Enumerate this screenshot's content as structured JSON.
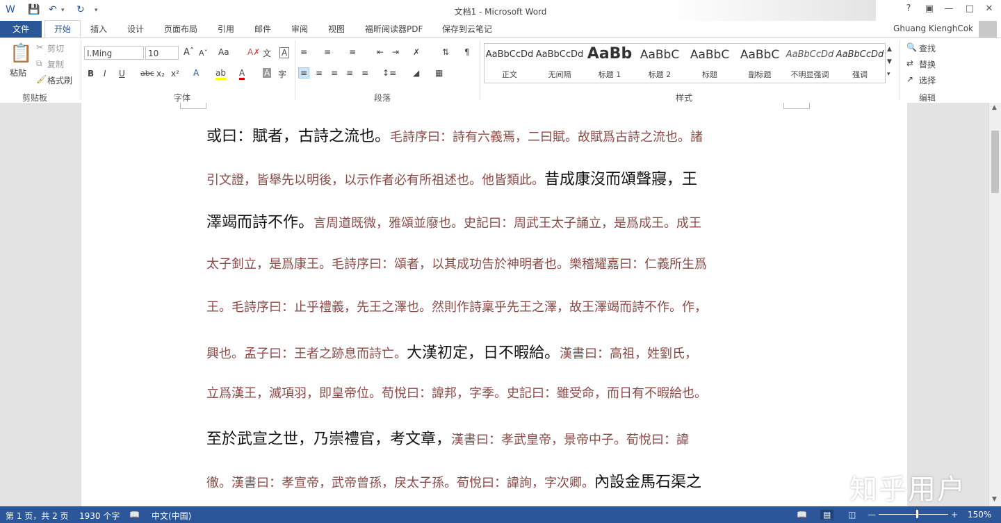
{
  "window": {
    "title": "文档1 - Microsoft Word"
  },
  "tabs": {
    "file": "文件",
    "items": [
      "开始",
      "插入",
      "设计",
      "页面布局",
      "引用",
      "邮件",
      "审阅",
      "视图",
      "福昕阅读器PDF",
      "保存到云笔记"
    ],
    "active": "开始"
  },
  "user": {
    "name": "Ghuang KienghCok"
  },
  "ribbon": {
    "clipboard": {
      "label": "剪贴板",
      "paste": "粘贴",
      "cut": "剪切",
      "copy": "复制",
      "format_painter": "格式刷"
    },
    "font": {
      "label": "字体",
      "name": "I.Ming",
      "size": "10",
      "bold": "B",
      "italic": "I",
      "underline": "U",
      "strike": "abc",
      "sub": "x₂",
      "sup": "x²",
      "case": "Aa"
    },
    "paragraph": {
      "label": "段落"
    },
    "styles": {
      "label": "样式",
      "items": [
        {
          "sample": "AaBbCcDd",
          "name": "正文"
        },
        {
          "sample": "AaBbCcDd",
          "name": "无间隔"
        },
        {
          "sample": "AaBb",
          "name": "标题 1"
        },
        {
          "sample": "AaBbC",
          "name": "标题 2"
        },
        {
          "sample": "AaBbC",
          "name": "标题"
        },
        {
          "sample": "AaBbC",
          "name": "副标题"
        },
        {
          "sample": "AaBbCcDd",
          "name": "不明显强调"
        },
        {
          "sample": "AaBbCcDd",
          "name": "强调"
        }
      ]
    },
    "editing": {
      "label": "编辑",
      "find": "查找",
      "replace": "替换",
      "select": "选择"
    }
  },
  "document": {
    "lines": [
      {
        "main": "或曰：賦者，古詩之流也。",
        "note": "毛詩序曰：詩有六義焉，二曰賦。故賦爲古詩之流也。諸"
      },
      {
        "note": "引文證，皆舉先以明後，以示作者必有所祖述也。他皆類此。",
        "main": "昔成康沒而頌聲寢，王"
      },
      {
        "main": "澤竭而詩不作。",
        "note": "言周道既微，雅頌並廢也。史記曰：周武王太子誦立，是爲成王。成王"
      },
      {
        "note": "太子釗立，是爲康王。毛詩序曰：頌者，以其成功告於神明者也。樂稽耀嘉曰：仁義所生爲"
      },
      {
        "note": "王。毛詩序曰：止乎禮義，先王之澤也。然則作詩稟乎先王之澤，故王澤竭而詩不作。作，"
      },
      {
        "note": "興也。孟子曰：王者之跡息而詩亡。",
        "main": "大漢初定，日不暇給。",
        "note2": "漢書曰：高祖，姓劉氏，"
      },
      {
        "note": "立爲漢王，滅項羽，即皇帝位。荀悅曰：諱邦，字季。史記曰：雖受命，而日有不暇給也。"
      },
      {
        "main": "至於武宣之世，乃崇禮官，考文章，",
        "note": "漢書曰：孝武皇帝，景帝中子。荀悅曰：諱"
      },
      {
        "note": "徹。漢書曰：孝宣帝，武帝曾孫，戾太子孫。荀悅曰：諱詢，字次卿。",
        "main": "內設金馬石渠之"
      }
    ]
  },
  "status": {
    "page": "第 1 页，共 2 页",
    "words": "1930 个字",
    "language": "中文(中国)",
    "zoom": "150%"
  },
  "watermark": "知乎用户"
}
